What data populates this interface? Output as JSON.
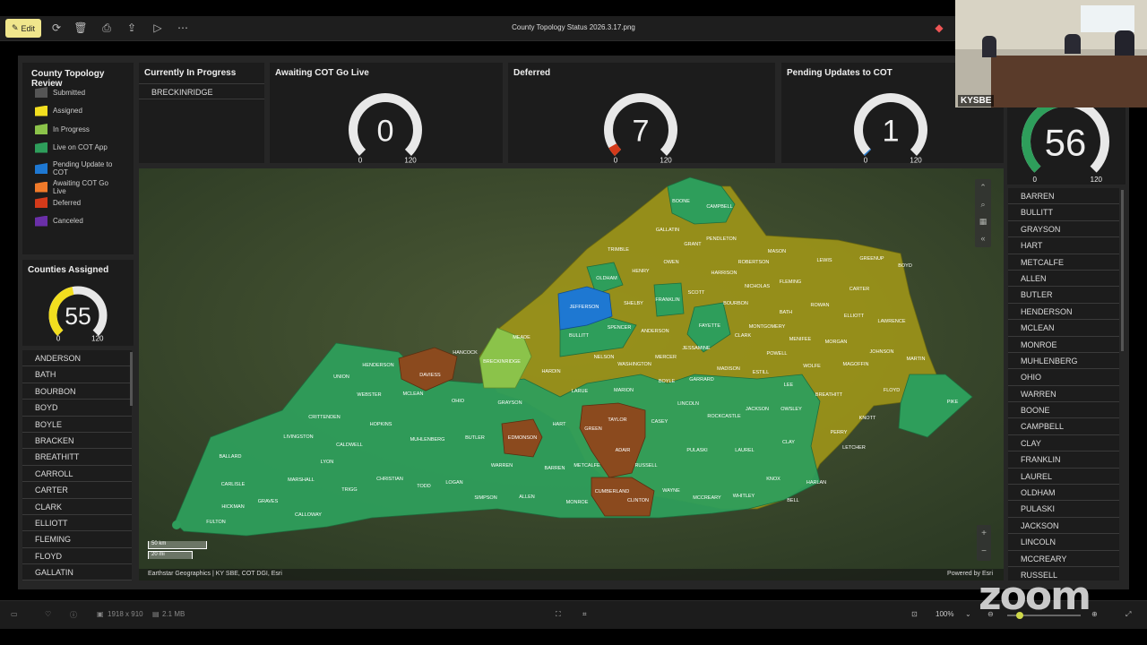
{
  "toolbar": {
    "edit_label": "Edit",
    "file_title": "County Topology Status 2026.3.17.png"
  },
  "legend": {
    "title": "County Topology Review",
    "items": [
      {
        "label": "Submitted",
        "color": "#555555"
      },
      {
        "label": "Assigned",
        "color": "#f2de1f"
      },
      {
        "label": "In Progress",
        "color": "#8bc34a"
      },
      {
        "label": "Live on COT App",
        "color": "#2e9e5b"
      },
      {
        "label": "Pending Update to COT",
        "color": "#1e78d2"
      },
      {
        "label": "Awaiting COT Go Live",
        "color": "#f07a2a"
      },
      {
        "label": "Deferred",
        "color": "#d33a1a"
      },
      {
        "label": "Canceled",
        "color": "#6a2fa8"
      }
    ]
  },
  "in_progress": {
    "title": "Currently In Progress",
    "items": [
      "BRECKINRIDGE"
    ]
  },
  "gauges": {
    "awaiting": {
      "title": "Awaiting COT Go Live",
      "value": "0",
      "min": "0",
      "max": "120",
      "fraction": 0,
      "color": "#f07a2a"
    },
    "deferred": {
      "title": "Deferred",
      "value": "7",
      "min": "0",
      "max": "120",
      "fraction": 0.058,
      "color": "#d33a1a"
    },
    "pending": {
      "title": "Pending Updates to COT",
      "value": "1",
      "min": "0",
      "max": "120",
      "fraction": 0.008,
      "color": "#1e78d2"
    },
    "live": {
      "value": "56",
      "min": "0",
      "max": "120",
      "fraction": 0.467,
      "color": "#2e9e5b"
    },
    "assigned": {
      "title": "Counties Assigned",
      "value": "55",
      "min": "0",
      "max": "120",
      "fraction": 0.458,
      "color": "#f2de1f"
    }
  },
  "assigned_list": [
    "ANDERSON",
    "BATH",
    "BOURBON",
    "BOYD",
    "BOYLE",
    "BRACKEN",
    "BREATHITT",
    "CARROLL",
    "CARTER",
    "CLARK",
    "ELLIOTT",
    "FLEMING",
    "FLOYD",
    "GALLATIN"
  ],
  "live_list": [
    "BARREN",
    "BULLITT",
    "GRAYSON",
    "HART",
    "METCALFE",
    "ALLEN",
    "BUTLER",
    "HENDERSON",
    "MCLEAN",
    "MONROE",
    "MUHLENBERG",
    "OHIO",
    "WARREN",
    "BOONE",
    "CAMPBELL",
    "CLAY",
    "FRANKLIN",
    "LAUREL",
    "OLDHAM",
    "PULASKI",
    "JACKSON",
    "LINCOLN",
    "MCCREARY",
    "RUSSELL"
  ],
  "map": {
    "attribution": "Earthstar Geographics | KY SBE, COT DGI, Esri",
    "powered": "Powered by Esri",
    "scale_km": "50 km",
    "scale_mi": "20 mi",
    "labels": [
      {
        "t": "BOONE"
      },
      {
        "t": "CAMPBELL"
      },
      {
        "t": "GALLATIN"
      },
      {
        "t": "GRANT"
      },
      {
        "t": "PENDLETON"
      },
      {
        "t": "TRIMBLE"
      },
      {
        "t": "MASON"
      },
      {
        "t": "OWEN"
      },
      {
        "t": "ROBERTSON"
      },
      {
        "t": "LEWIS"
      },
      {
        "t": "GREENUP"
      },
      {
        "t": "BOYD"
      },
      {
        "t": "HENRY"
      },
      {
        "t": "HARRISON"
      },
      {
        "t": "OLDHAM"
      },
      {
        "t": "SCOTT"
      },
      {
        "t": "NICHOLAS"
      },
      {
        "t": "FLEMING"
      },
      {
        "t": "CARTER"
      },
      {
        "t": "SHELBY"
      },
      {
        "t": "FRANKLIN"
      },
      {
        "t": "BOURBON"
      },
      {
        "t": "ROWAN"
      },
      {
        "t": "JEFFERSON"
      },
      {
        "t": "BATH"
      },
      {
        "t": "ELLIOTT"
      },
      {
        "t": "LAWRENCE"
      },
      {
        "t": "FAYETTE"
      },
      {
        "t": "SPENCER"
      },
      {
        "t": "ANDERSON"
      },
      {
        "t": "CLARK"
      },
      {
        "t": "MONTGOMERY"
      },
      {
        "t": "BULLITT"
      },
      {
        "t": "MEADE"
      },
      {
        "t": "MENIFEE"
      },
      {
        "t": "MORGAN"
      },
      {
        "t": "JESSAMINE"
      },
      {
        "t": "HANCOCK"
      },
      {
        "t": "JOHNSON"
      },
      {
        "t": "MARTIN"
      },
      {
        "t": "NELSON"
      },
      {
        "t": "MERCER"
      },
      {
        "t": "POWELL"
      },
      {
        "t": "BRECKINRIDGE"
      },
      {
        "t": "WASHINGTON"
      },
      {
        "t": "WOLFE"
      },
      {
        "t": "MAGOFFIN"
      },
      {
        "t": "HENDERSON"
      },
      {
        "t": "DAVIESS"
      },
      {
        "t": "HARDIN"
      },
      {
        "t": "MADISON"
      },
      {
        "t": "ESTILL"
      },
      {
        "t": "UNION"
      },
      {
        "t": "GARRARD"
      },
      {
        "t": "BOYLE"
      },
      {
        "t": "LEE"
      },
      {
        "t": "FLOYD"
      },
      {
        "t": "LARUE"
      },
      {
        "t": "MARION"
      },
      {
        "t": "BREATHITT"
      },
      {
        "t": "WEBSTER"
      },
      {
        "t": "MCLEAN"
      },
      {
        "t": "PIKE"
      },
      {
        "t": "OHIO"
      },
      {
        "t": "LINCOLN"
      },
      {
        "t": "JACKSON"
      },
      {
        "t": "OWSLEY"
      },
      {
        "t": "GRAYSON"
      },
      {
        "t": "CRITTENDEN"
      },
      {
        "t": "TAYLOR"
      },
      {
        "t": "CASEY"
      },
      {
        "t": "ROCKCASTLE"
      },
      {
        "t": "KNOTT"
      },
      {
        "t": "HOPKINS"
      },
      {
        "t": "HART"
      },
      {
        "t": "GREEN"
      },
      {
        "t": "PERRY"
      },
      {
        "t": "LIVINGSTON"
      },
      {
        "t": "MUHLENBERG"
      },
      {
        "t": "BUTLER"
      },
      {
        "t": "EDMONSON"
      },
      {
        "t": "CLAY"
      },
      {
        "t": "CALDWELL"
      },
      {
        "t": "LETCHER"
      },
      {
        "t": "ADAIR"
      },
      {
        "t": "PULASKI"
      },
      {
        "t": "LAUREL"
      },
      {
        "t": "BALLARD"
      },
      {
        "t": "LYON"
      },
      {
        "t": "WARREN"
      },
      {
        "t": "METCALFE"
      },
      {
        "t": "RUSSELL"
      },
      {
        "t": "BARREN"
      },
      {
        "t": "CHRISTIAN"
      },
      {
        "t": "KNOX"
      },
      {
        "t": "CARLISLE"
      },
      {
        "t": "MARSHALL"
      },
      {
        "t": "HARLAN"
      },
      {
        "t": "TODD"
      },
      {
        "t": "LOGAN"
      },
      {
        "t": "TRIGG"
      },
      {
        "t": "CUMBERLAND"
      },
      {
        "t": "WAYNE"
      },
      {
        "t": "SIMPSON"
      },
      {
        "t": "ALLEN"
      },
      {
        "t": "HICKMAN"
      },
      {
        "t": "GRAVES"
      },
      {
        "t": "MCCREARY"
      },
      {
        "t": "WHITLEY"
      },
      {
        "t": "CLINTON"
      },
      {
        "t": "MONROE"
      },
      {
        "t": "BELL"
      },
      {
        "t": "CALLOWAY"
      },
      {
        "t": "FULTON"
      }
    ]
  },
  "bottombar": {
    "dimensions": "1918 x 910",
    "size": "2.1 MB",
    "zoom": "100%"
  },
  "video": {
    "label": "KYSBE"
  },
  "zoom_brand": "zoom"
}
